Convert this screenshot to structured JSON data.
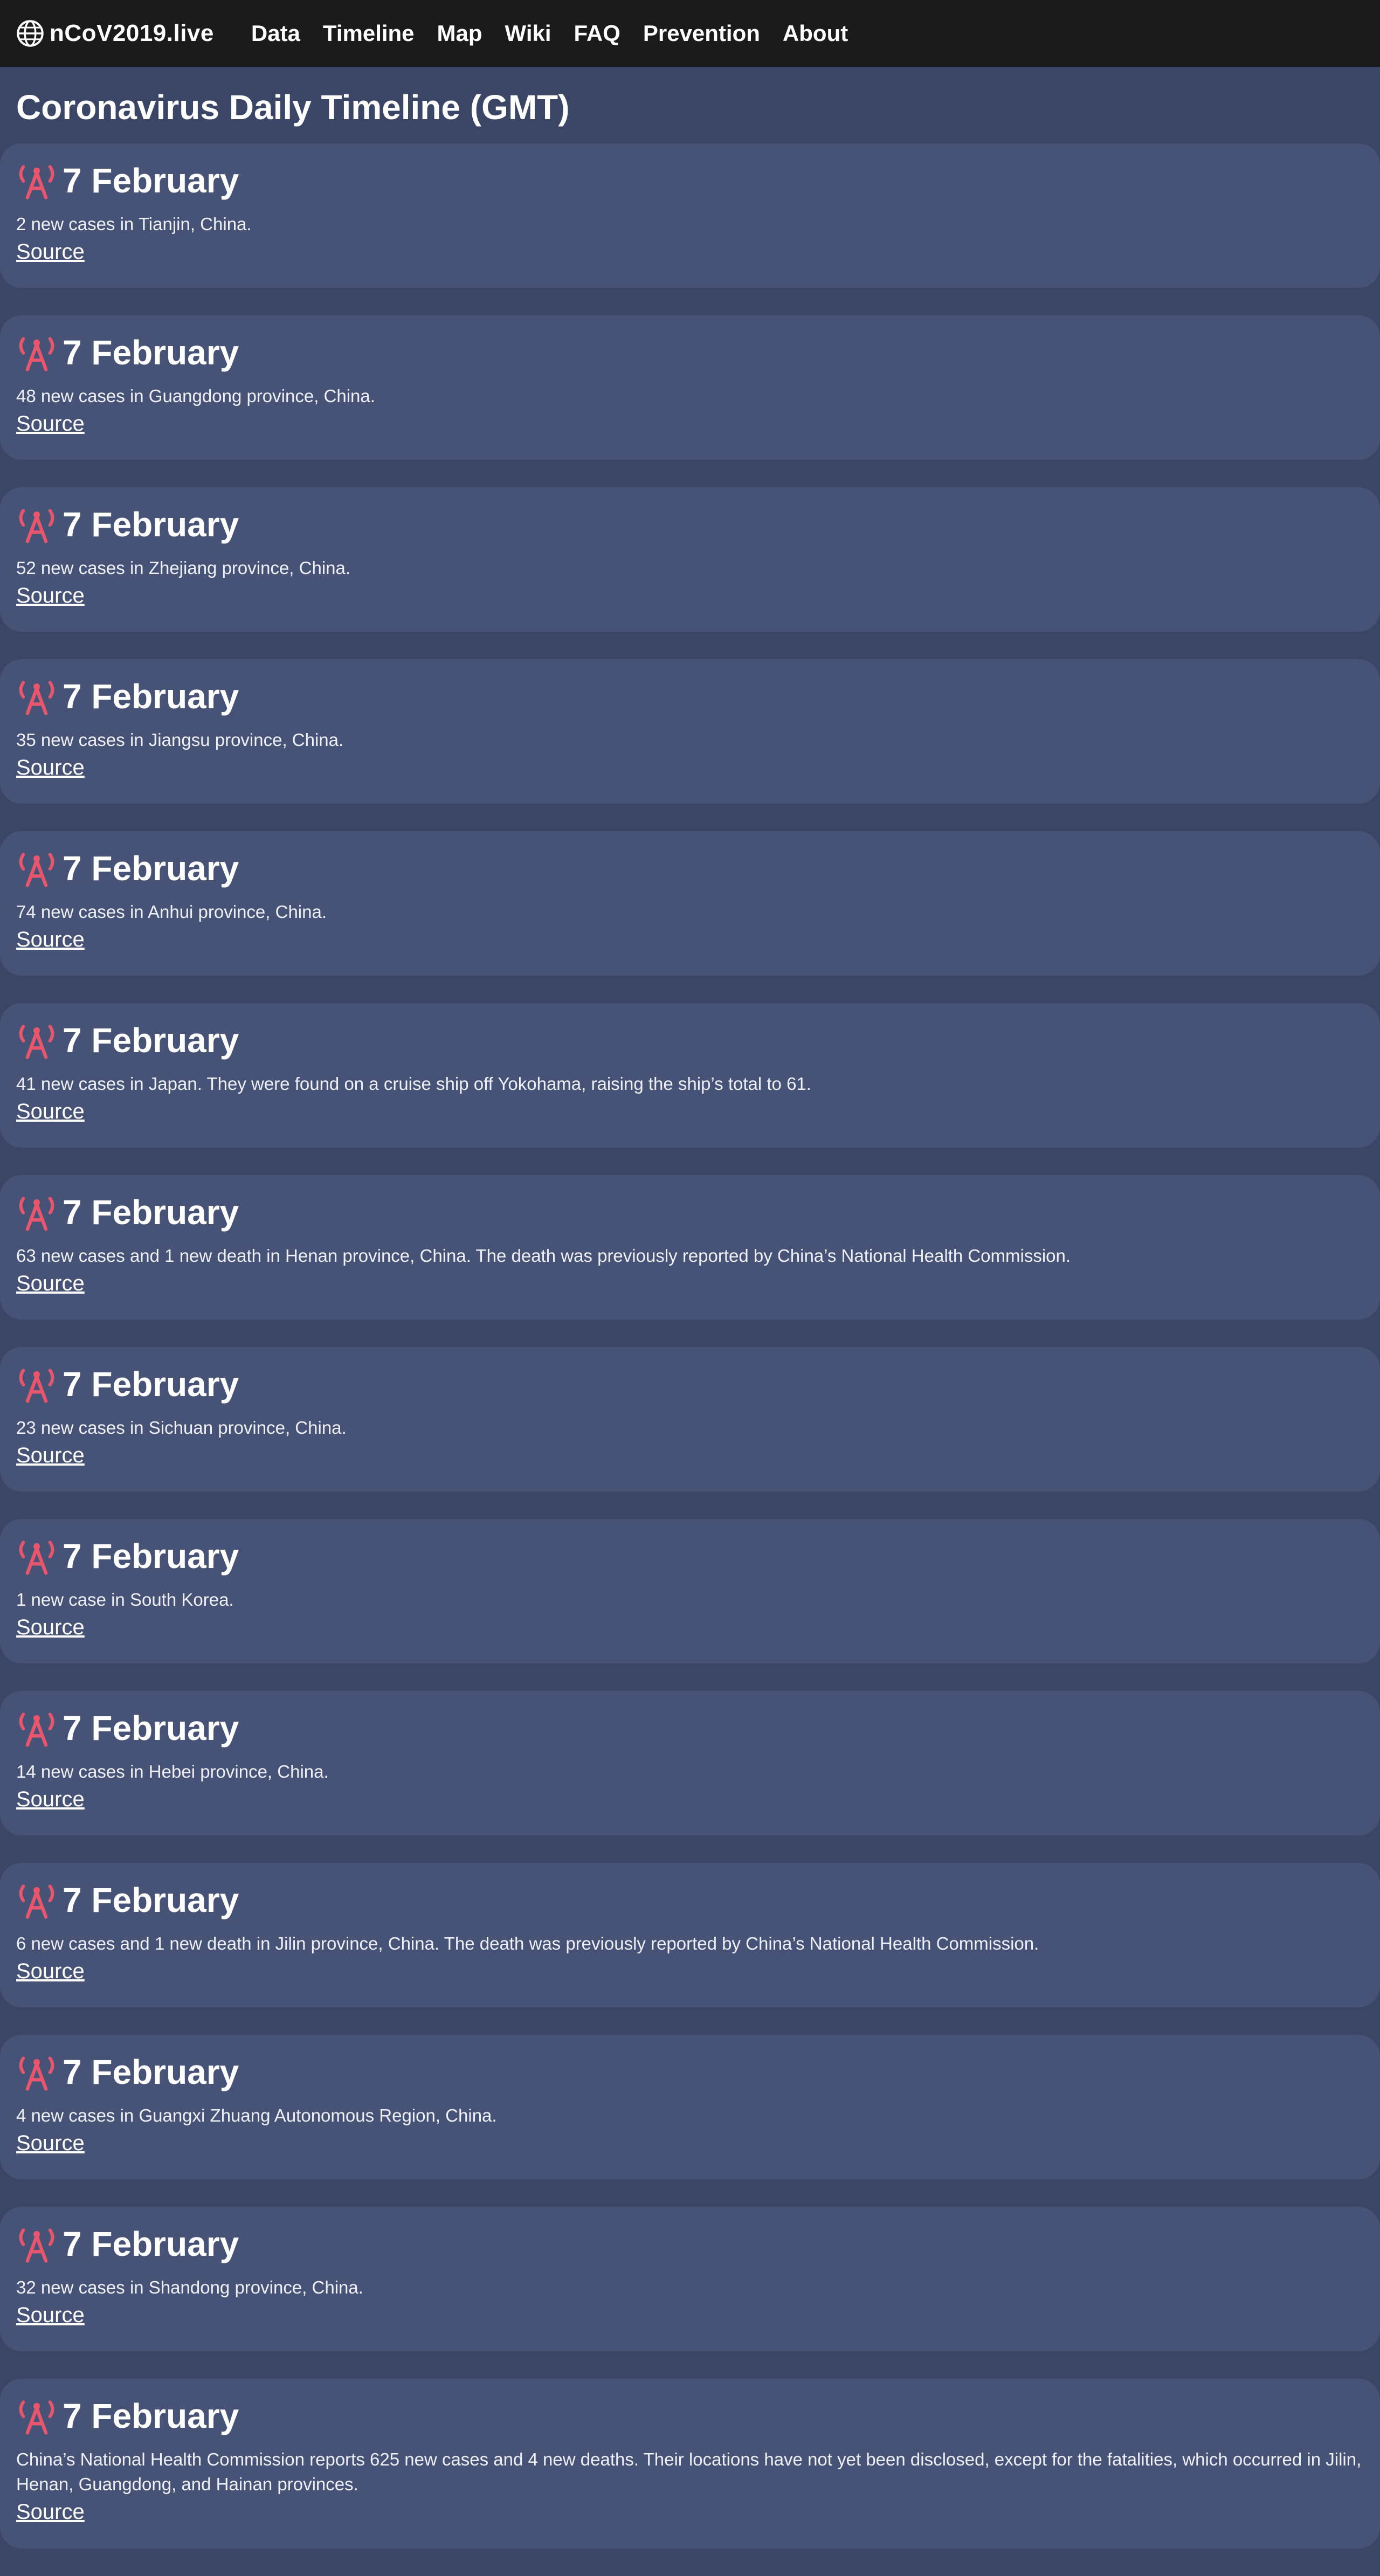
{
  "nav": {
    "brand": "nCoV2019.live",
    "links": [
      "Data",
      "Timeline",
      "Map",
      "Wiki",
      "FAQ",
      "Prevention",
      "About"
    ]
  },
  "colors": {
    "page_bg": "#3b4566",
    "card_bg": "#465377",
    "nav_bg": "#1b1b1b",
    "icon_accent": "#e8566e"
  },
  "page_title": "Coronavirus Daily Timeline (GMT)",
  "source_label": "Source",
  "icon_name": "broadcast-tower-icon",
  "entries": [
    {
      "date": "7 February",
      "text": "2 new cases in Tianjin, China."
    },
    {
      "date": "7 February",
      "text": "48 new cases in Guangdong province, China."
    },
    {
      "date": "7 February",
      "text": "52 new cases in Zhejiang province, China."
    },
    {
      "date": "7 February",
      "text": "35 new cases in Jiangsu province, China."
    },
    {
      "date": "7 February",
      "text": "74 new cases in Anhui province, China."
    },
    {
      "date": "7 February",
      "text": "41 new cases in Japan. They were found on a cruise ship off Yokohama, raising the ship’s total to 61."
    },
    {
      "date": "7 February",
      "text": "63 new cases and 1 new death in Henan province, China. The death was previously reported by China’s National Health Commission."
    },
    {
      "date": "7 February",
      "text": "23 new cases in Sichuan province, China."
    },
    {
      "date": "7 February",
      "text": "1 new case in South Korea."
    },
    {
      "date": "7 February",
      "text": "14 new cases in Hebei province, China."
    },
    {
      "date": "7 February",
      "text": "6 new cases and 1 new death in Jilin province, China. The death was previously reported by China’s National Health Commission."
    },
    {
      "date": "7 February",
      "text": "4 new cases in Guangxi Zhuang Autonomous Region, China."
    },
    {
      "date": "7 February",
      "text": "32 new cases in Shandong province, China."
    },
    {
      "date": "7 February",
      "text": "China’s National Health Commission reports 625 new cases and 4 new deaths. Their locations have not yet been disclosed, except for the fatalities, which occurred in Jilin, Henan, Guangdong, and Hainan provinces."
    }
  ]
}
